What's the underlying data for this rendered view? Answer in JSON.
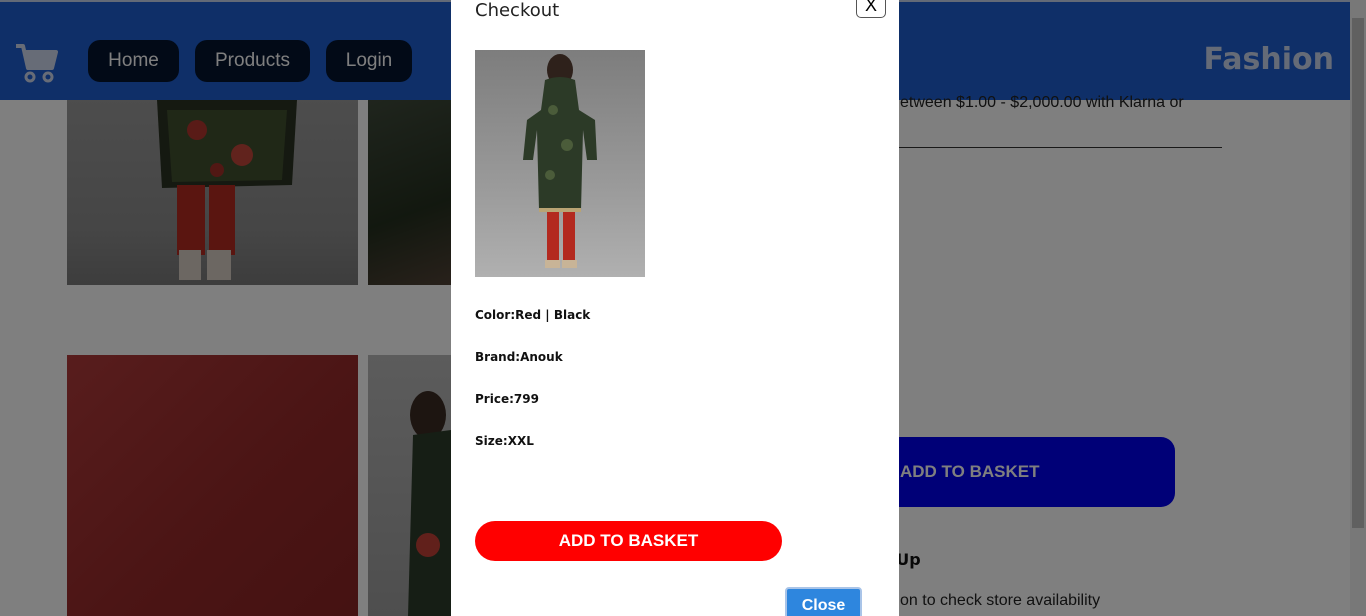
{
  "nav": {
    "home": "Home",
    "products": "Products",
    "login": "Login",
    "brand": "Fashion"
  },
  "background": {
    "finance_text": "etween $1.00 - $2,000.00 with Klarna or",
    "add_to_basket": "ADD TO BASKET",
    "pickup_heading": "k Up",
    "store_text": "on to check store availability"
  },
  "modal": {
    "title": "Checkout",
    "close_x": "X",
    "details": [
      {
        "label": "Color:",
        "value": "Red | Black"
      },
      {
        "label": "Brand:",
        "value": "Anouk"
      },
      {
        "label": "Price:",
        "value": "799"
      },
      {
        "label": "Size:",
        "value": "XXL"
      }
    ],
    "add_to_basket": "ADD TO BASKET",
    "close_button": "Close"
  },
  "colors": {
    "navbar": "#1f5fd0",
    "nav_button": "#04142f",
    "modal_add": "#ff0000",
    "bg_add": "#0000ee",
    "close_button": "#2e86de"
  },
  "icons": {
    "cart": "shopping-cart-icon"
  }
}
